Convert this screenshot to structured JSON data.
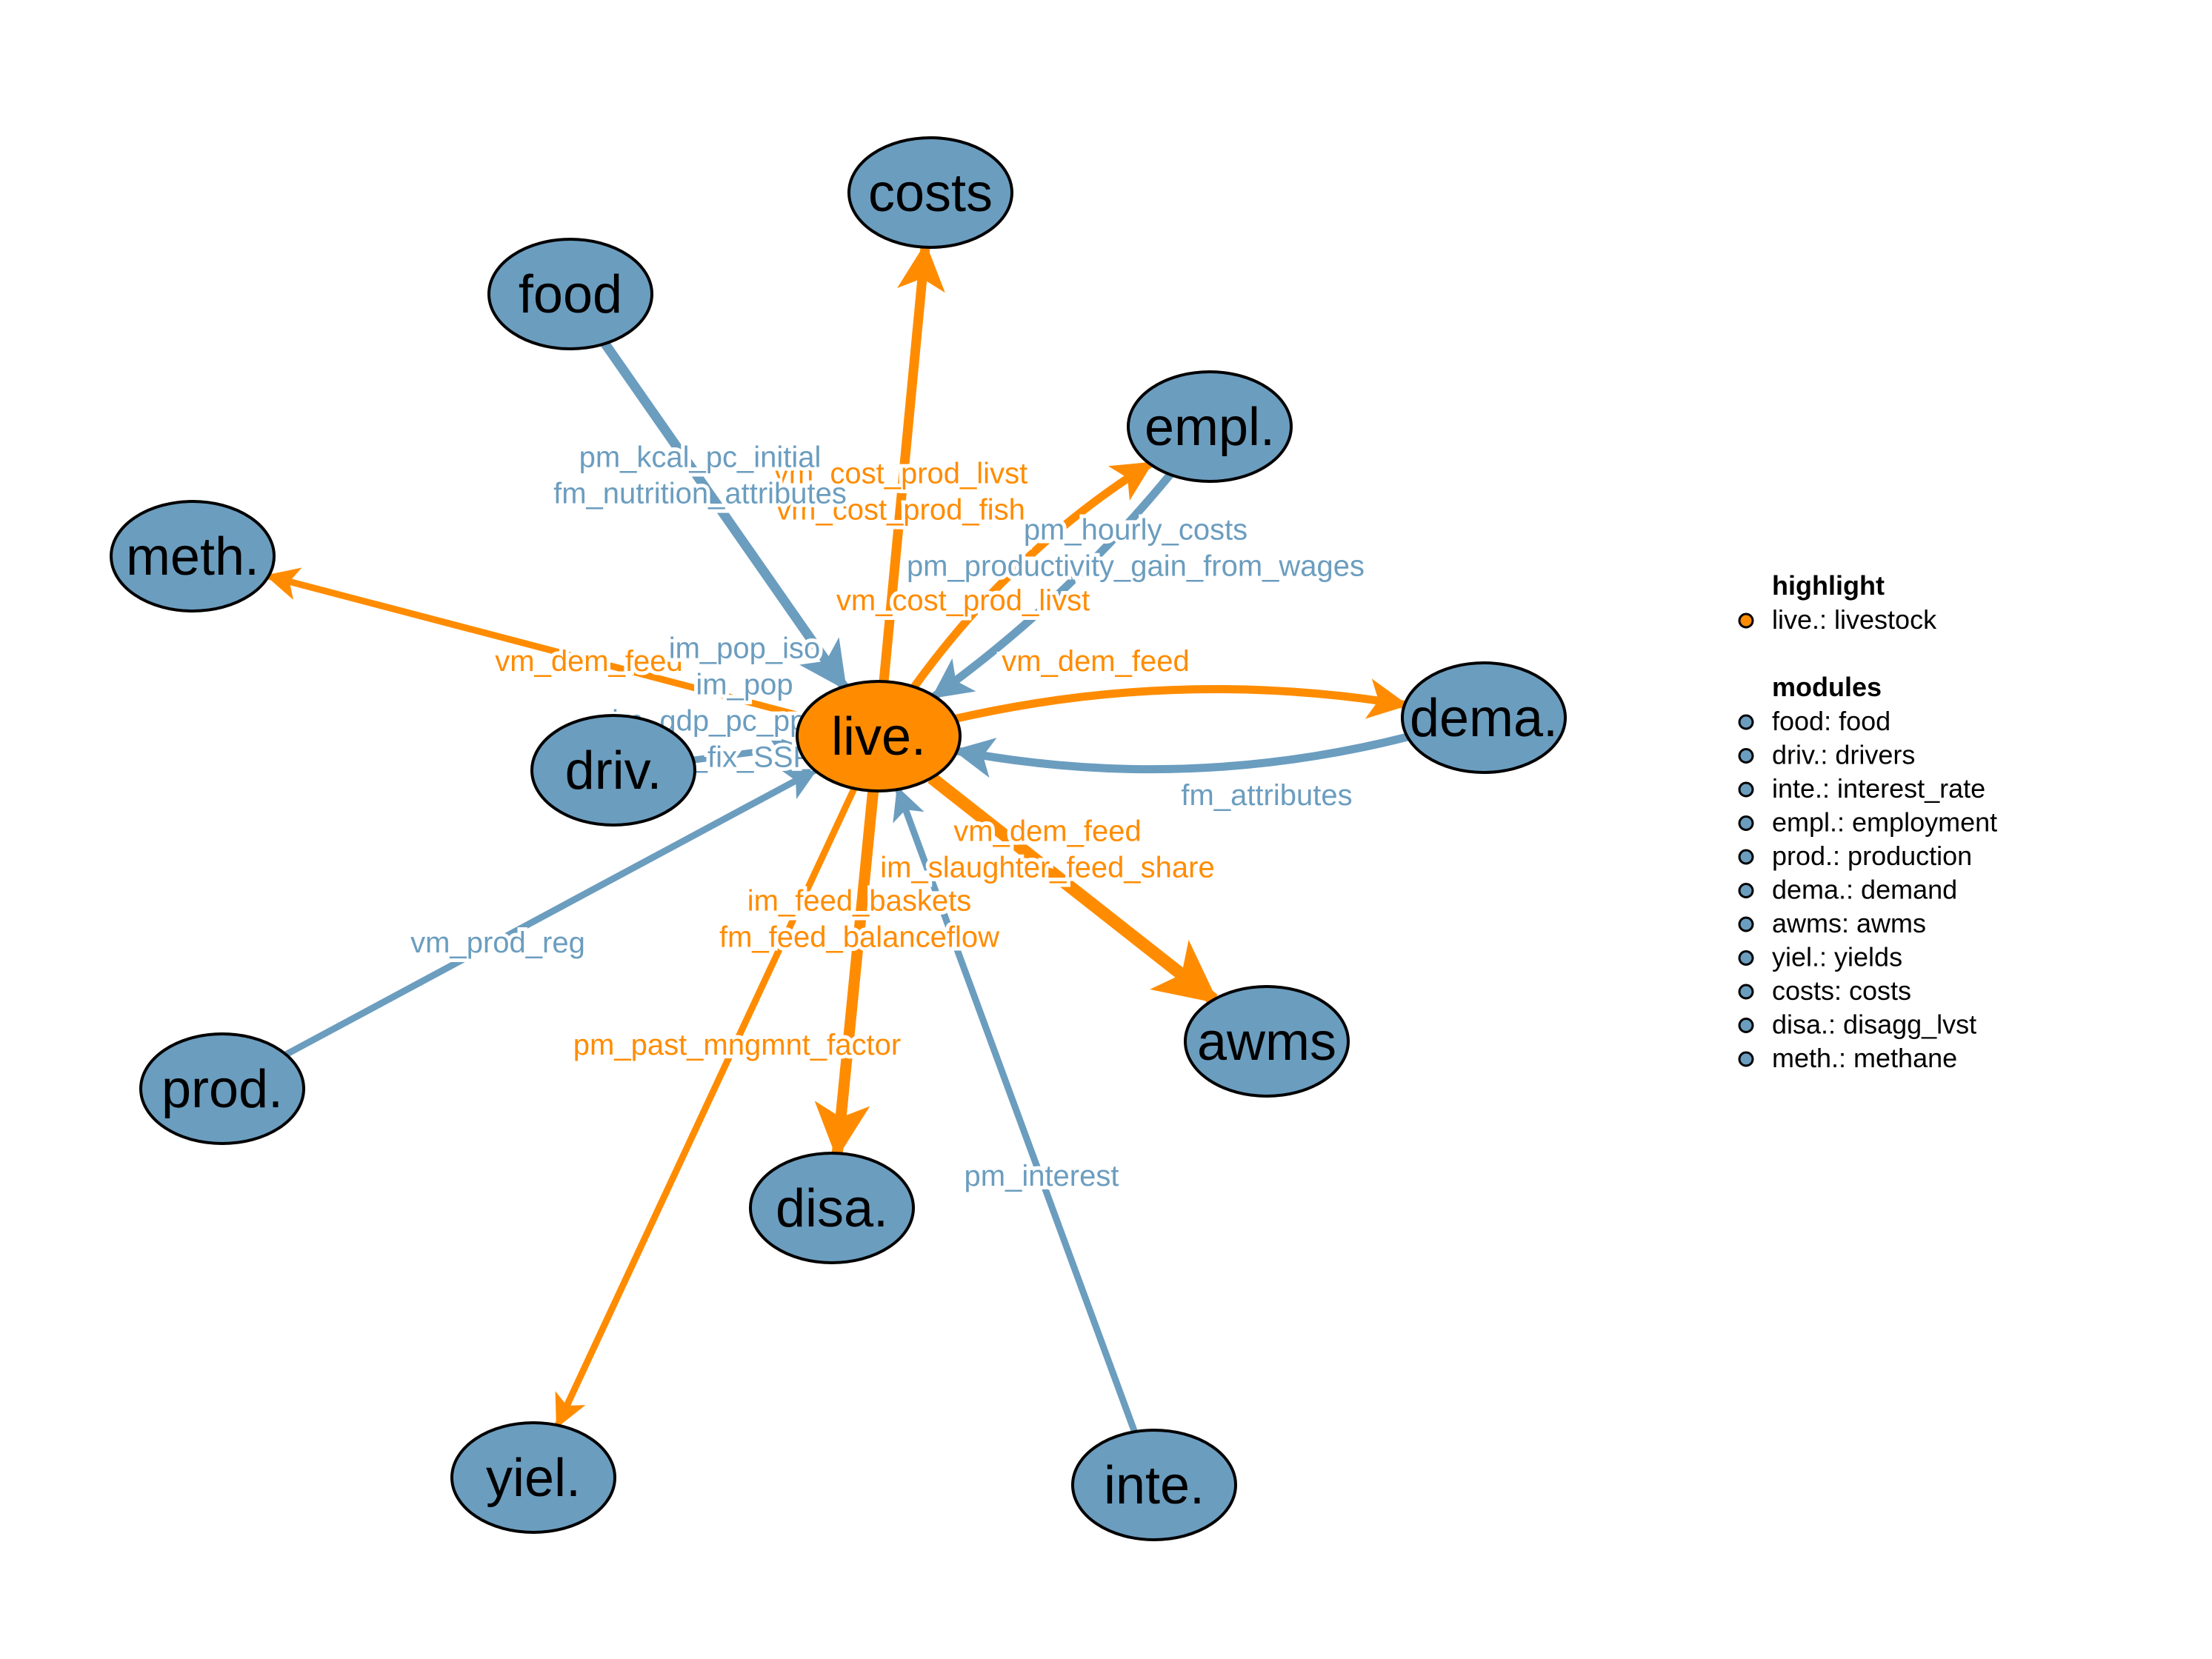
{
  "colors": {
    "highlight": "#FF8C00",
    "module": "#6B9DBF",
    "highlight_edge": "#FF8C00",
    "module_edge": "#6B9DBF",
    "outline": "#000000"
  },
  "nodes": [
    {
      "id": "live",
      "label": "live.",
      "group": "highlight"
    },
    {
      "id": "costs",
      "label": "costs",
      "group": "module"
    },
    {
      "id": "food",
      "label": "food",
      "group": "module"
    },
    {
      "id": "empl",
      "label": "empl.",
      "group": "module"
    },
    {
      "id": "meth",
      "label": "meth.",
      "group": "module"
    },
    {
      "id": "dema",
      "label": "dema.",
      "group": "module"
    },
    {
      "id": "driv",
      "label": "driv.",
      "group": "module"
    },
    {
      "id": "awms",
      "label": "awms",
      "group": "module"
    },
    {
      "id": "prod",
      "label": "prod.",
      "group": "module"
    },
    {
      "id": "disa",
      "label": "disa.",
      "group": "module"
    },
    {
      "id": "yiel",
      "label": "yiel.",
      "group": "module"
    },
    {
      "id": "inte",
      "label": "inte.",
      "group": "module"
    }
  ],
  "edges": [
    {
      "from": "live",
      "to": "costs",
      "type": "highlight",
      "labels": [
        "vm_cost_prod_livst",
        "vm_cost_prod_fish"
      ]
    },
    {
      "from": "food",
      "to": "live",
      "type": "module",
      "labels": [
        "pm_kcal_pc_initial",
        "fm_nutrition_attributes"
      ]
    },
    {
      "from": "live",
      "to": "empl",
      "type": "highlight",
      "labels": [
        "vm_cost_prod_livst"
      ]
    },
    {
      "from": "empl",
      "to": "live",
      "type": "module",
      "labels": [
        "pm_hourly_costs",
        "pm_productivity_gain_from_wages"
      ]
    },
    {
      "from": "live",
      "to": "meth",
      "type": "highlight",
      "labels": [
        "vm_dem_feed"
      ]
    },
    {
      "from": "live",
      "to": "dema",
      "type": "highlight",
      "labels": [
        "vm_dem_feed"
      ]
    },
    {
      "from": "dema",
      "to": "live",
      "type": "module",
      "labels": [
        "fm_attributes"
      ]
    },
    {
      "from": "driv",
      "to": "live",
      "type": "module",
      "labels": [
        "im_pop_iso",
        "im_pop",
        "im_gdp_pc_ppp_iso",
        "im_fix_SSP2"
      ]
    },
    {
      "from": "live",
      "to": "awms",
      "type": "highlight",
      "labels": [
        "vm_dem_feed",
        "im_slaughter_feed_share"
      ]
    },
    {
      "from": "prod",
      "to": "live",
      "type": "module",
      "labels": [
        "vm_prod_reg"
      ]
    },
    {
      "from": "live",
      "to": "disa",
      "type": "highlight",
      "labels": [
        "im_feed_baskets",
        "fm_feed_balanceflow"
      ]
    },
    {
      "from": "live",
      "to": "yiel",
      "type": "highlight",
      "labels": [
        "pm_past_mngmnt_factor"
      ]
    },
    {
      "from": "inte",
      "to": "live",
      "type": "module",
      "labels": [
        "pm_interest"
      ]
    }
  ],
  "legend": {
    "highlight_title": "highlight",
    "highlight_items": [
      {
        "text": "live.: livestock",
        "group": "highlight"
      }
    ],
    "modules_title": "modules",
    "module_items": [
      {
        "text": "food: food",
        "group": "module"
      },
      {
        "text": "driv.: drivers",
        "group": "module"
      },
      {
        "text": "inte.: interest_rate",
        "group": "module"
      },
      {
        "text": "empl.: employment",
        "group": "module"
      },
      {
        "text": "prod.: production",
        "group": "module"
      },
      {
        "text": "dema.: demand",
        "group": "module"
      },
      {
        "text": "awms: awms",
        "group": "module"
      },
      {
        "text": "yiel.: yields",
        "group": "module"
      },
      {
        "text": "costs: costs",
        "group": "module"
      },
      {
        "text": "disa.: disagg_lvst",
        "group": "module"
      },
      {
        "text": "meth.: methane",
        "group": "module"
      }
    ]
  }
}
